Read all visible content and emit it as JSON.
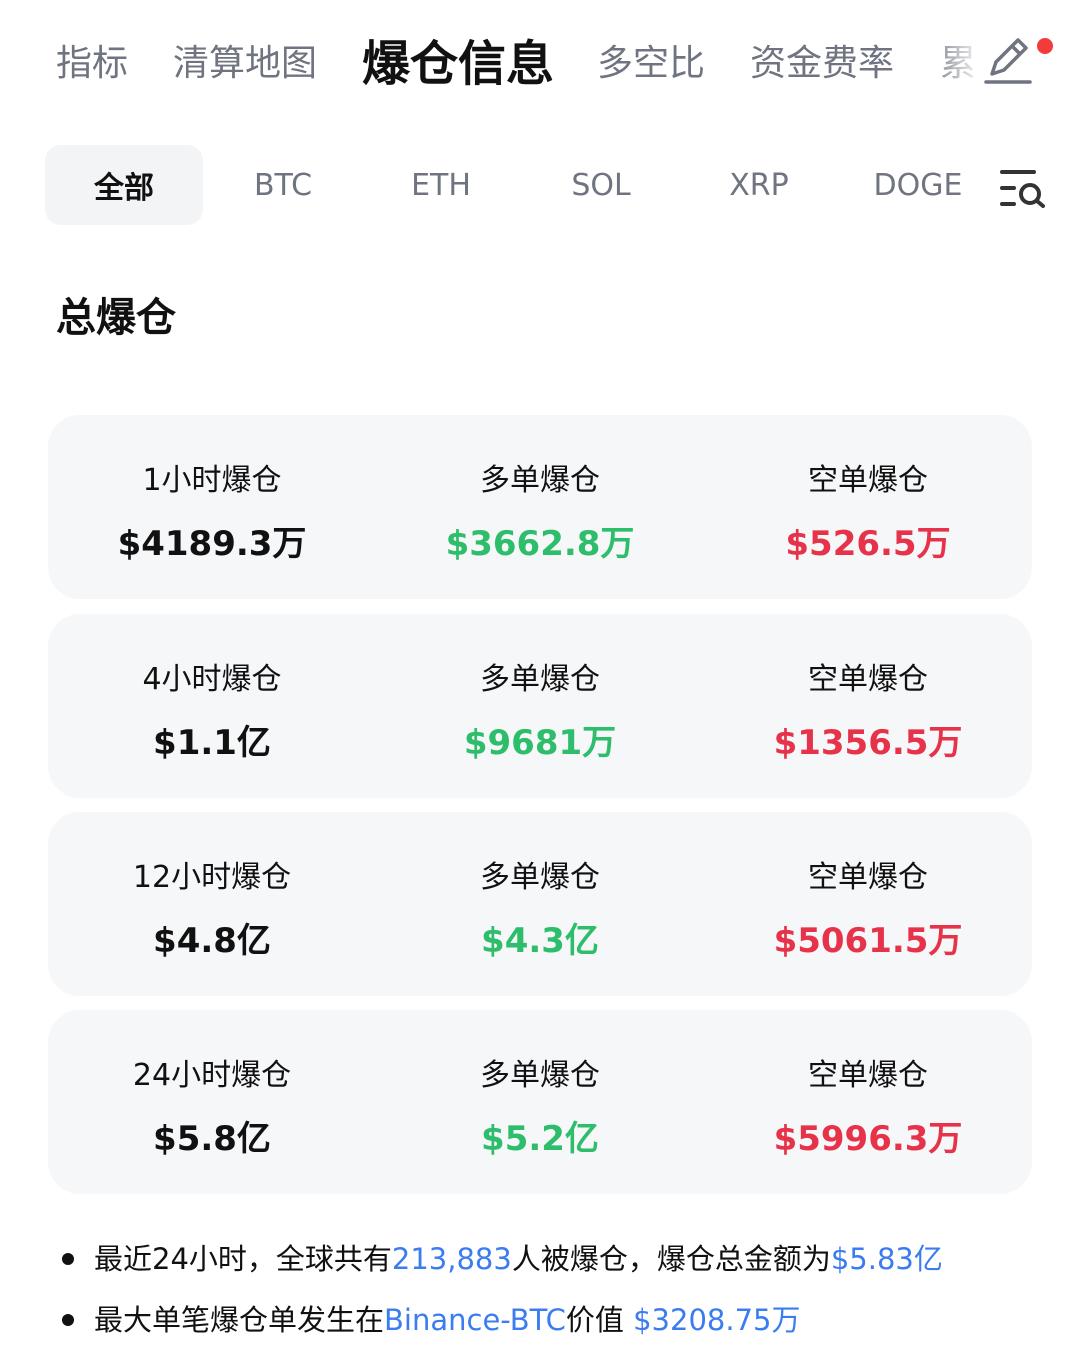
{
  "topnav": {
    "tabs": [
      {
        "label": "指标"
      },
      {
        "label": "清算地图"
      },
      {
        "label": "爆仓信息"
      },
      {
        "label": "多空比"
      },
      {
        "label": "资金费率"
      }
    ],
    "overflow_label": "累"
  },
  "coin_tabs": [
    {
      "label": "全部"
    },
    {
      "label": "BTC"
    },
    {
      "label": "ETH"
    },
    {
      "label": "SOL"
    },
    {
      "label": "XRP"
    },
    {
      "label": "DOGE"
    }
  ],
  "section": {
    "title": "总爆仓"
  },
  "rows": [
    {
      "period_label": "1小时爆仓",
      "total": "$4189.3万",
      "long_label": "多单爆仓",
      "long": "$3662.8万",
      "short_label": "空单爆仓",
      "short": "$526.5万"
    },
    {
      "period_label": "4小时爆仓",
      "total": "$1.1亿",
      "long_label": "多单爆仓",
      "long": "$9681万",
      "short_label": "空单爆仓",
      "short": "$1356.5万"
    },
    {
      "period_label": "12小时爆仓",
      "total": "$4.8亿",
      "long_label": "多单爆仓",
      "long": "$4.3亿",
      "short_label": "空单爆仓",
      "short": "$5061.5万"
    },
    {
      "period_label": "24小时爆仓",
      "total": "$5.8亿",
      "long_label": "多单爆仓",
      "long": "$5.2亿",
      "short_label": "空单爆仓",
      "short": "$5996.3万"
    }
  ],
  "summary": {
    "line1": {
      "a": "最近24小时，全球共有",
      "count": "213,883",
      "b": "人被爆仓，爆仓总金额为",
      "total": "$5.83亿"
    },
    "line2": {
      "a": "最大单笔爆仓单发生在",
      "exchange": "Binance-BTC",
      "b": "价值 ",
      "value": "$3208.75万"
    }
  },
  "colors": {
    "long": "#2ebd6b",
    "short": "#e7334a",
    "link": "#3b7cf0",
    "card_bg": "#f6f7f9",
    "badge": "#f23c3c"
  }
}
